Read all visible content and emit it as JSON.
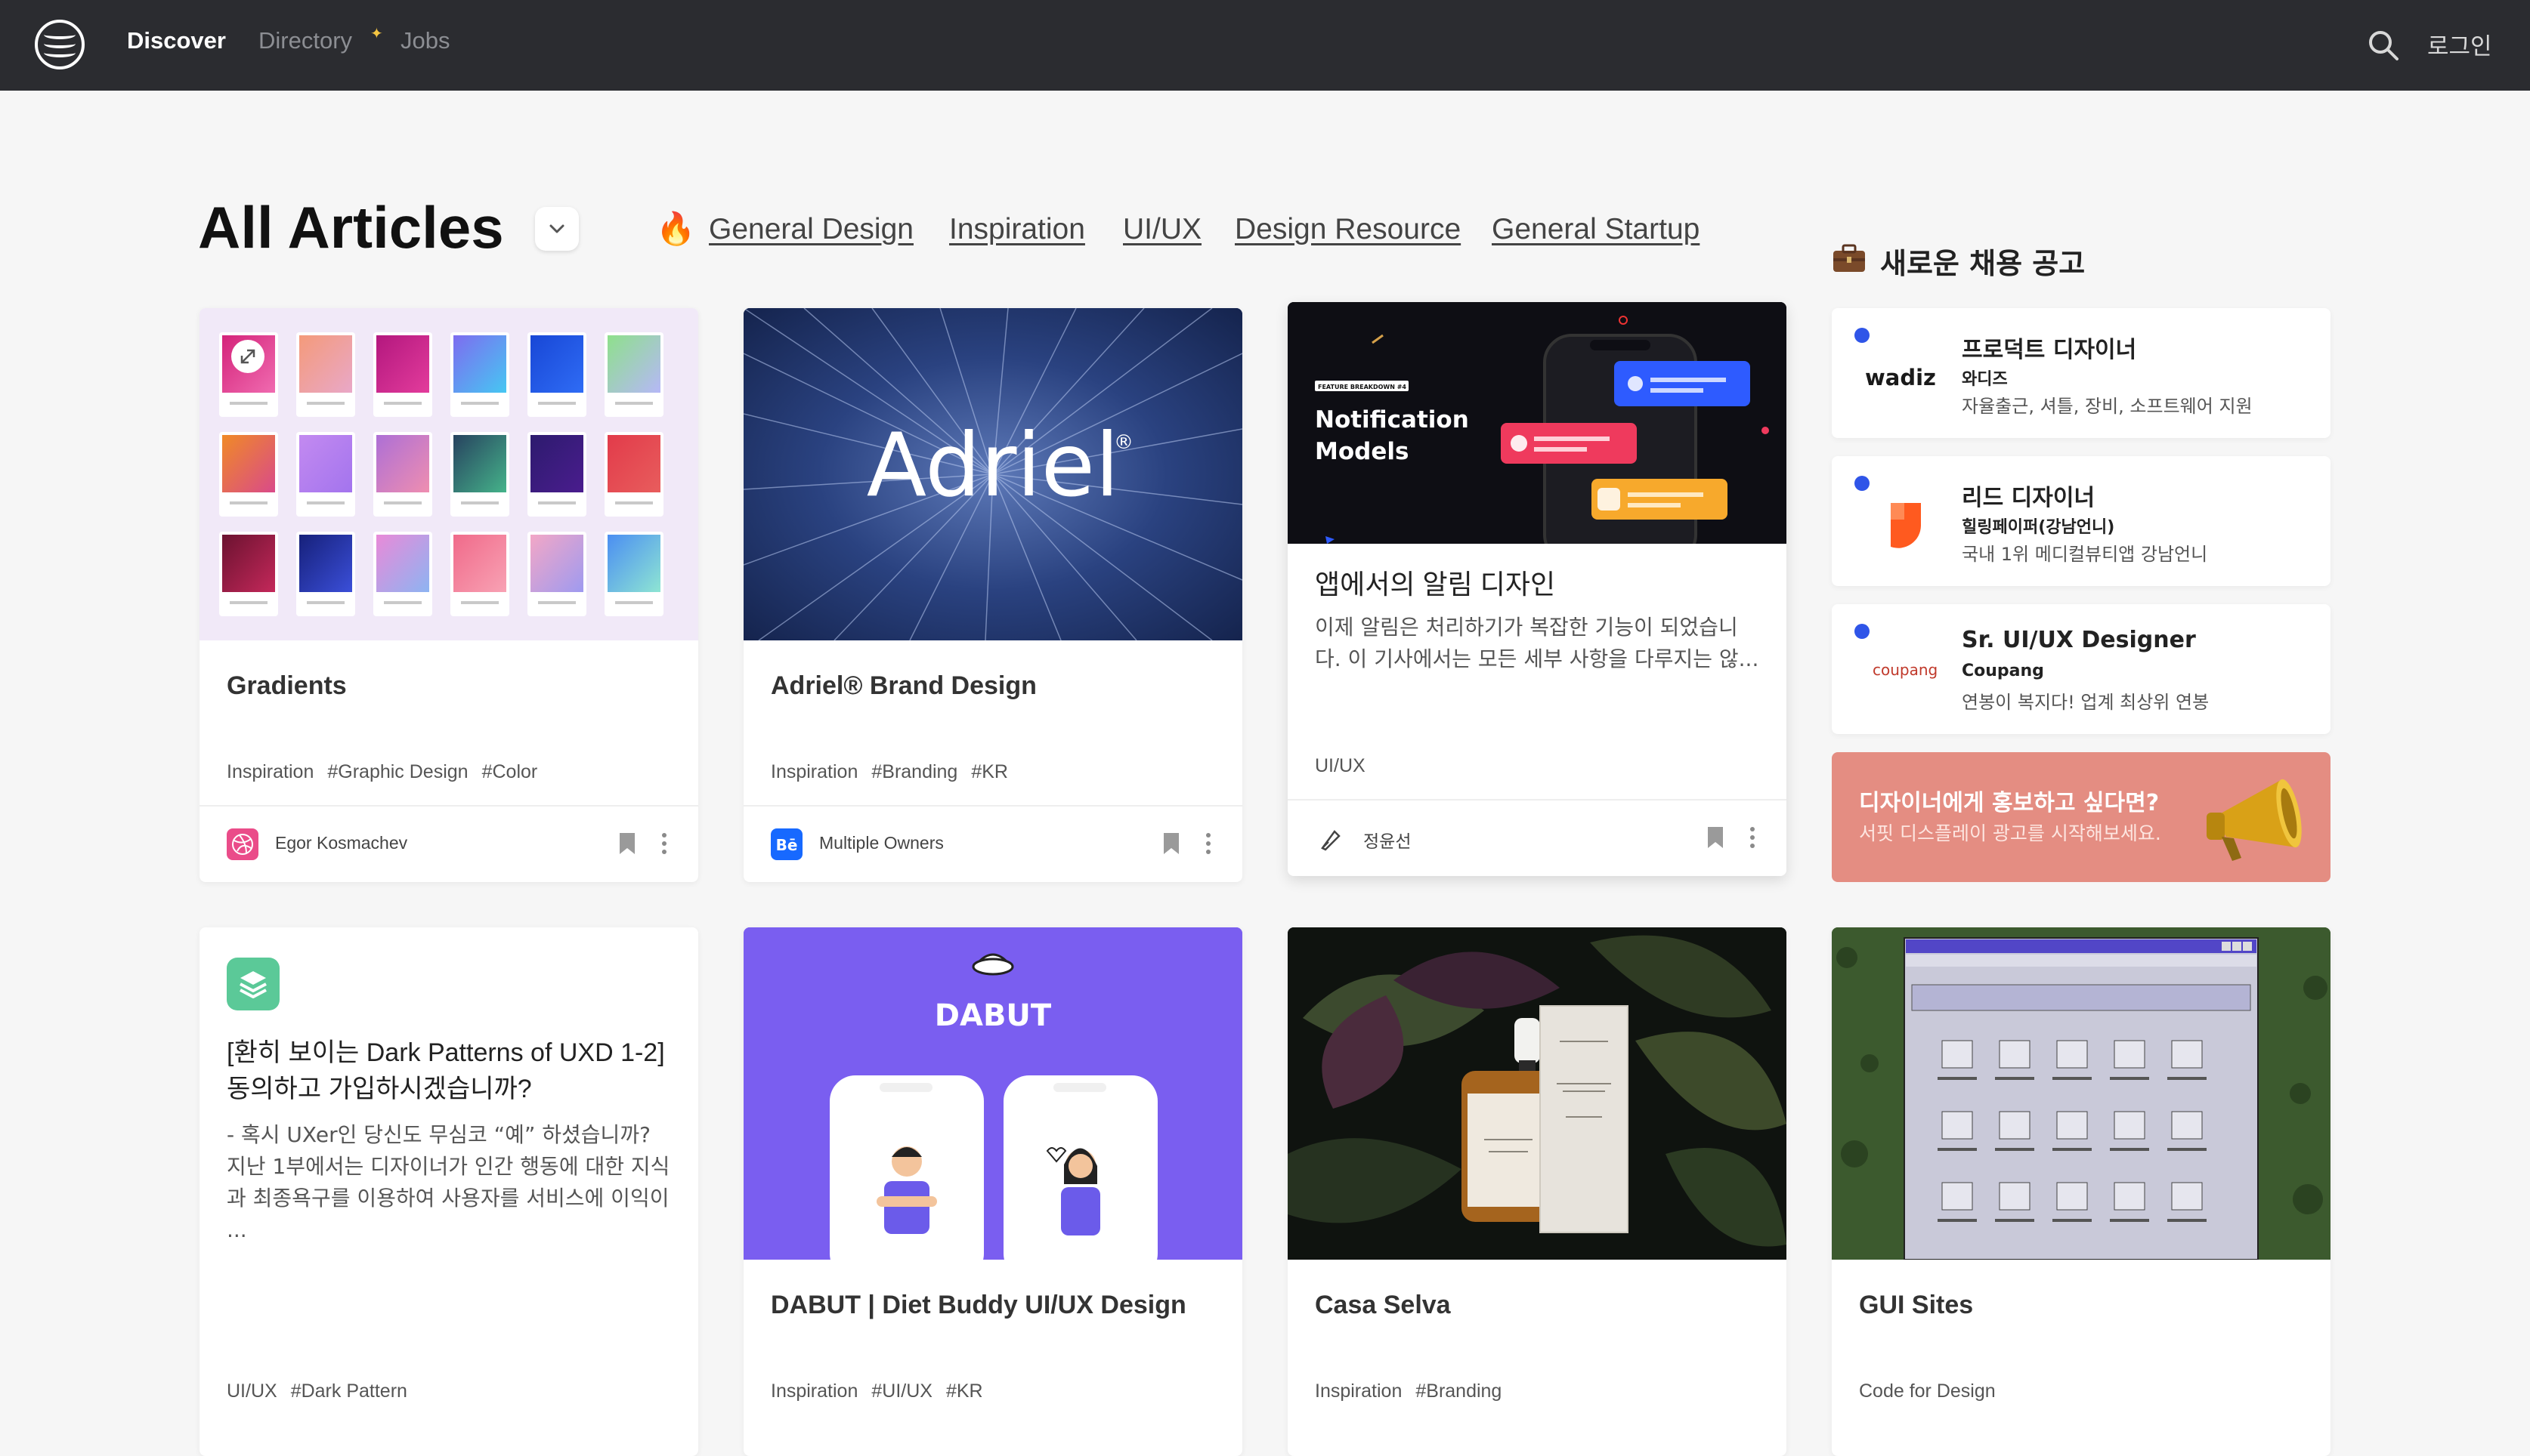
{
  "nav": {
    "items": [
      {
        "label": "Discover"
      },
      {
        "label": "Directory"
      },
      {
        "label": "Jobs"
      }
    ],
    "login": "로그인"
  },
  "header": {
    "title": "All Articles",
    "categories": [
      "General Design",
      "Inspiration",
      "UI/UX",
      "Design Resource",
      "General Startup"
    ]
  },
  "thumb_text": {
    "adriel_logo": "Adriel",
    "notification_badge": "FEATURE BREAKDOWN #4",
    "notification_title_1": "Notification",
    "notification_title_2": "Models",
    "dabut_logo": "DABUT"
  },
  "cards": [
    {
      "title": "Gradients",
      "tags": [
        "Inspiration",
        "#Graphic Design",
        "#Color"
      ],
      "author": "Egor Kosmachev"
    },
    {
      "title": "Adriel® Brand Design",
      "tags": [
        "Inspiration",
        "#Branding",
        "#KR"
      ],
      "author": "Multiple Owners"
    },
    {
      "title": "앱에서의 알림 디자인",
      "desc": "이제 알림은 처리하기가 복잡한 기능이 되었습니다. 이 기사에서는 모든 세부 사항을 다루지는 않...",
      "tags": [
        "UI/UX"
      ],
      "author": "정윤선"
    },
    {
      "title": "[환히 보이는 Dark Patterns of UXD 1-2] 동의하고 가입하시겠습니까?",
      "desc": "- 혹시 UXer인 당신도 무심코 “예” 하셨습니까?   지난 1부에서는 디자이너가 인간 행동에 대한 지식과 최종욕구를 이용하여 사용자를 서비스에 이익이 ...",
      "tags": [
        "UI/UX",
        "#Dark Pattern"
      ]
    },
    {
      "title": "DABUT | Diet Buddy UI/UX Design",
      "tags": [
        "Inspiration",
        "#UI/UX",
        "#KR"
      ]
    },
    {
      "title": "Casa Selva",
      "tags": [
        "Inspiration",
        "#Branding"
      ]
    },
    {
      "title": "GUI Sites",
      "tags": [
        "Code for Design"
      ]
    }
  ],
  "jobs": {
    "heading": "새로운 채용 공고",
    "items": [
      {
        "title": "프로덕트 디자이너",
        "company": "와디즈",
        "desc": "자율출근, 셔틀, 장비, 소프트웨어 지원",
        "logo_text": "wadiz"
      },
      {
        "title": "리드 디자이너",
        "company": "힐링페이퍼(강남언니)",
        "desc": "국내 1위 메디컬뷰티앱 강남언니"
      },
      {
        "title": "Sr. UI/UX Designer",
        "company": "Coupang",
        "desc": "연봉이 복지다! 업계 최상위 연봉",
        "logo_text": "coupang"
      }
    ],
    "promo": {
      "title": "디자이너에게 홍보하고 싶다면?",
      "sub": "서핏 디스플레이 광고를 시작해보세요."
    }
  },
  "colors": {
    "nav_bg": "#2b2c30",
    "accent_blue": "#2f55e8",
    "promo_bg": "#e48d82"
  }
}
